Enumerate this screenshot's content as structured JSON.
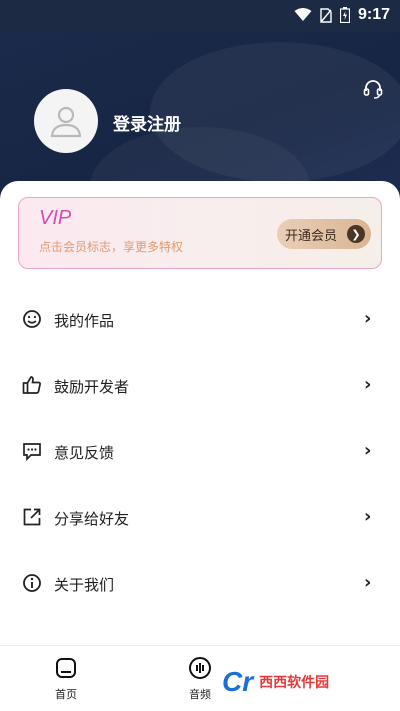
{
  "status_bar": {
    "time": "9:17"
  },
  "profile": {
    "login_label": "登录注册"
  },
  "vip": {
    "title": "VIP",
    "subtitle": "点击会员标志，享更多特权",
    "button_label": "开通会员"
  },
  "menu": {
    "items": [
      {
        "label": "我的作品",
        "icon": "smile-icon"
      },
      {
        "label": "鼓励开发者",
        "icon": "thumbs-up-icon"
      },
      {
        "label": "意见反馈",
        "icon": "feedback-icon"
      },
      {
        "label": "分享给好友",
        "icon": "share-icon"
      },
      {
        "label": "关于我们",
        "icon": "info-icon"
      }
    ]
  },
  "tabbar": {
    "home_label": "首页",
    "audio_label": "音频"
  },
  "watermark": {
    "logo": "Cr",
    "text": "西西软件园"
  },
  "colors": {
    "header_bg": "#1b2a4a",
    "vip_accent": "#d64bb0",
    "vip_button": "#e9cfb6"
  }
}
